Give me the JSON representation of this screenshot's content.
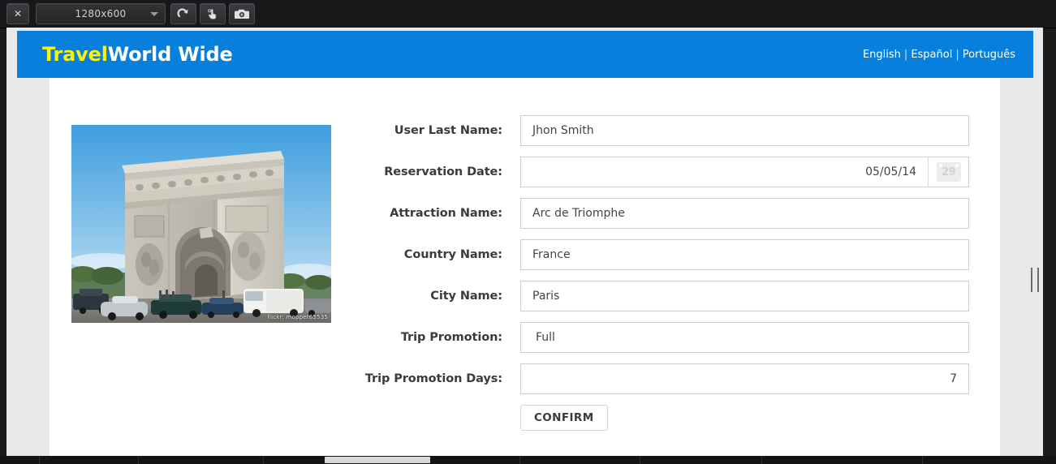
{
  "emulator": {
    "close_label": "✕",
    "resolution": "1280x600",
    "buttons": [
      {
        "name": "rotate-button",
        "icon": "rotate-icon"
      },
      {
        "name": "touch-button",
        "icon": "hand-touch-icon"
      },
      {
        "name": "screenshot-button",
        "icon": "camera-icon"
      }
    ]
  },
  "header": {
    "brand_first": "Travel",
    "brand_second": "World Wide",
    "brand_color_first": "#fbf10a",
    "brand_color_second": "#ffffff",
    "background_color": "#0680dc",
    "languages": [
      "English",
      "Español",
      "Português"
    ],
    "separator": "|"
  },
  "photo": {
    "alt": "Arc de Triomphe, Paris",
    "credit": "flickr: moppet65535"
  },
  "form": {
    "rows": [
      {
        "label": "User Last Name:",
        "value": "Jhon Smith",
        "align": "left",
        "addon": false
      },
      {
        "label": "Reservation Date:",
        "value": "05/05/14",
        "align": "right",
        "addon": true,
        "addon_text": "29"
      },
      {
        "label": "Attraction Name:",
        "value": "Arc de Triomphe",
        "align": "left",
        "addon": false
      },
      {
        "label": "Country Name:",
        "value": "France",
        "align": "left",
        "addon": false
      },
      {
        "label": "City Name:",
        "value": "Paris",
        "align": "left",
        "addon": false
      },
      {
        "label": "Trip Promotion:",
        "value": "Full",
        "align": "indent",
        "addon": false
      },
      {
        "label": "Trip Promotion Days:",
        "value": "7",
        "align": "right",
        "addon": false
      }
    ],
    "confirm_label": "CONFIRM"
  }
}
